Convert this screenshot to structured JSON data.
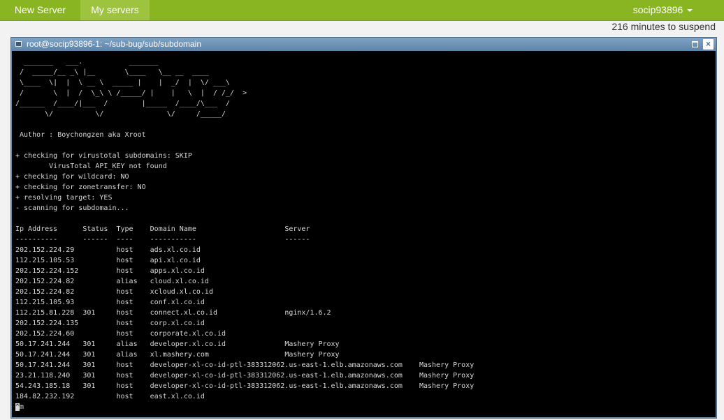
{
  "nav": {
    "new_server": "New Server",
    "my_servers": "My servers",
    "user": "socip93896",
    "user_caret_icon": "caret-down-icon"
  },
  "status": {
    "suspend": "216 minutes to suspend"
  },
  "window": {
    "title": "root@socip93896-1: ~/sub-bug/sub/subdomain",
    "icon": "terminal-icon",
    "maximize_icon": "maximize-icon",
    "close_label": "×"
  },
  "terminal": {
    "lines": [
      "  _______   ___.           _______",
      " /  _____/__ _\\ |__       \\____   \\__ __  ____",
      " \\____  \\|  |  \\ __ \\  _____ |    |  _/  |  \\/ ___\\",
      " /       \\  |  /  \\_\\ \\ /_____/ |    |   \\  |  / /_/  >",
      "/______  /____/|___  /        |_____  /____/\\___  /",
      "       \\/          \\/               \\/     /_____/",
      "",
      " Author : Boychongzen aka Xroot",
      "",
      "+ checking for virustotal subdomains: SKIP",
      "        VirusTotal API_KEY not found",
      "+ checking for wildcard: NO",
      "+ checking for zonetransfer: NO",
      "+ resolving target: YES",
      "- scanning for subdomain...",
      "",
      "Ip Address      Status  Type    Domain Name                     Server",
      "----------      ------  ----    -----------                     ------",
      "202.152.224.29          host    ads.xl.co.id",
      "112.215.105.53          host    api.xl.co.id",
      "202.152.224.152         host    apps.xl.co.id",
      "202.152.224.82          alias   cloud.xl.co.id",
      "202.152.224.82          host    xcloud.xl.co.id",
      "112.215.105.93          host    conf.xl.co.id",
      "112.215.81.228  301     host    connect.xl.co.id                nginx/1.6.2",
      "202.152.224.135         host    corp.xl.co.id",
      "202.152.224.60          host    corporate.xl.co.id",
      "50.17.241.244   301     alias   developer.xl.co.id              Mashery Proxy",
      "50.17.241.244   301     alias   xl.mashery.com                  Mashery Proxy",
      "50.17.241.244   301     host    developer-xl-co-id-ptl-383312062.us-east-1.elb.amazonaws.com    Mashery Proxy",
      "23.21.118.240   301     host    developer-xl-co-id-ptl-383312062.us-east-1.elb.amazonaws.com    Mashery Proxy",
      "54.243.185.18   301     host    developer-xl-co-id-ptl-383312062.us-east-1.elb.amazonaws.com    Mashery Proxy",
      "184.82.232.192          host    east.xl.co.id"
    ],
    "cursor_char": "^",
    "cursor_after": "m"
  }
}
